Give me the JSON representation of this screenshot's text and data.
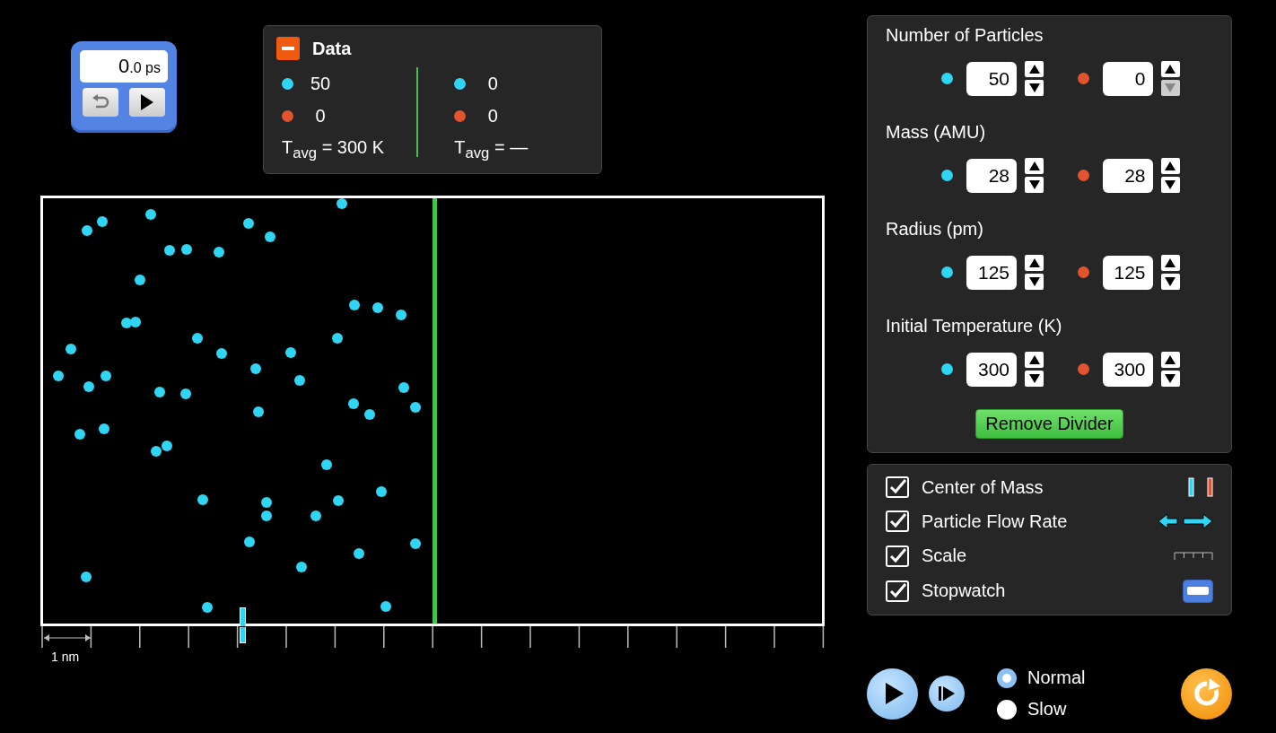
{
  "stopwatch": {
    "whole": "0",
    "fraction": ".0",
    "unit": "ps"
  },
  "data_panel": {
    "title": "Data",
    "expanded": true,
    "sides": [
      {
        "counts": [
          {
            "color": "#2fd5f2",
            "value": "50"
          },
          {
            "color": "#e2532f",
            "value": "0"
          }
        ],
        "temperature": "T$_{avg}$ = 300 K"
      },
      {
        "counts": [
          {
            "color": "#2fd5f2",
            "value": "0"
          },
          {
            "color": "#e2532f",
            "value": "0"
          }
        ],
        "temperature": "T$_{avg}$ = —"
      }
    ]
  },
  "container": {
    "divider": true
  },
  "scale": {
    "label": "1 nm"
  },
  "parameters": [
    {
      "label": "Number of Particles",
      "values": [
        {
          "color": "#2fd5f2",
          "value": "50",
          "down_disabled": false
        },
        {
          "color": "#e2532f",
          "value": "0",
          "down_disabled": true
        }
      ]
    },
    {
      "label": "Mass (AMU)",
      "values": [
        {
          "color": "#2fd5f2",
          "value": "28",
          "down_disabled": false
        },
        {
          "color": "#e2532f",
          "value": "28",
          "down_disabled": false
        }
      ]
    },
    {
      "label": "Radius (pm)",
      "values": [
        {
          "color": "#2fd5f2",
          "value": "125",
          "down_disabled": false
        },
        {
          "color": "#e2532f",
          "value": "125",
          "down_disabled": false
        }
      ]
    },
    {
      "label": "Initial Temperature (K)",
      "values": [
        {
          "color": "#2fd5f2",
          "value": "300",
          "down_disabled": false
        },
        {
          "color": "#e2532f",
          "value": "300",
          "down_disabled": false
        }
      ]
    }
  ],
  "remove_divider_button": "Remove Divider",
  "options": [
    {
      "label": "Center of Mass",
      "checked": true,
      "kind": "center-of-mass"
    },
    {
      "label": "Particle Flow Rate",
      "checked": true,
      "kind": "flow-rate"
    },
    {
      "label": "Scale",
      "checked": true,
      "kind": "scale"
    },
    {
      "label": "Stopwatch",
      "checked": true,
      "kind": "stopwatch"
    }
  ],
  "speed": [
    {
      "label": "Normal",
      "selected": true
    },
    {
      "label": "Slow",
      "selected": false
    }
  ]
}
